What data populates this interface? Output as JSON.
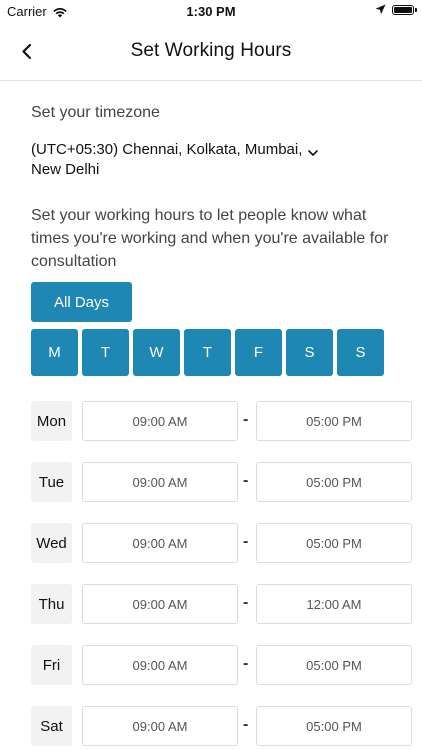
{
  "status_bar": {
    "carrier": "Carrier",
    "time": "1:30 PM"
  },
  "header": {
    "title": "Set Working Hours"
  },
  "timezone": {
    "label": "Set your timezone",
    "value": "(UTC+05:30) Chennai, Kolkata, Mumbai, New Delhi"
  },
  "description": "Set your working hours to let people know what times you're working and when you're available for consultation",
  "all_days_label": "All Days",
  "weekday_buttons": [
    "M",
    "T",
    "W",
    "T",
    "F",
    "S",
    "S"
  ],
  "schedule": [
    {
      "day": "Mon",
      "start": "09:00 AM",
      "end": "05:00 PM"
    },
    {
      "day": "Tue",
      "start": "09:00 AM",
      "end": "05:00 PM"
    },
    {
      "day": "Wed",
      "start": "09:00 AM",
      "end": "05:00 PM"
    },
    {
      "day": "Thu",
      "start": "09:00 AM",
      "end": "12:00 AM"
    },
    {
      "day": "Fri",
      "start": "09:00 AM",
      "end": "05:00 PM"
    },
    {
      "day": "Sat",
      "start": "09:00 AM",
      "end": "05:00 PM"
    }
  ],
  "separator": "-",
  "colors": {
    "accent": "#1f87b3",
    "day_label_bg": "#f2f2f2",
    "border": "#dcdcdc"
  },
  "icons": {
    "back": "chevron-left-icon",
    "dropdown": "chevron-down-icon",
    "wifi": "wifi-icon",
    "location": "location-arrow-icon",
    "battery": "battery-icon"
  }
}
